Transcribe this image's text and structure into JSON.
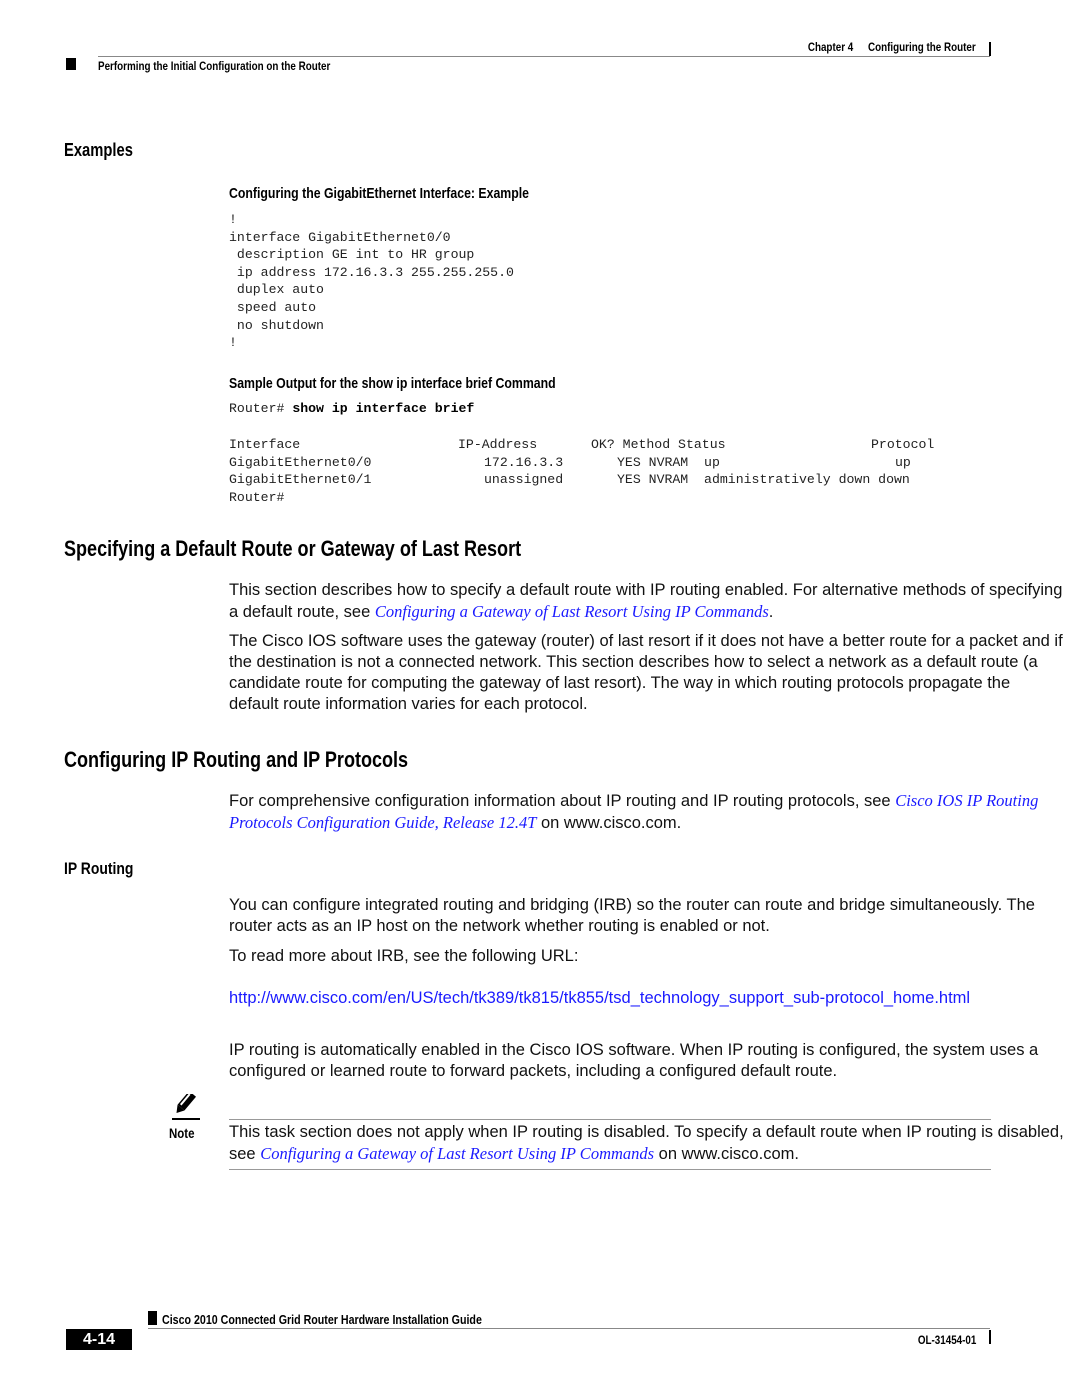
{
  "header": {
    "chapter_label": "Chapter 4",
    "chapter_title": "Configuring the Router",
    "section_title": "Performing the Initial Configuration on the Router"
  },
  "examples": {
    "heading": "Examples",
    "example1": {
      "title": "Configuring the GigabitEthernet Interface: Example",
      "code": "!\ninterface GigabitEthernet0/0\n description GE int to HR group\n ip address 172.16.3.3 255.255.255.0\n duplex auto\n speed auto\n no shutdown\n!"
    },
    "example2": {
      "title": "Sample Output for the show ip interface brief Command",
      "prompt": "Router# ",
      "command": "show ip interface brief",
      "columns": [
        "Interface",
        "IP-Address",
        "OK? Method Status",
        "Protocol"
      ],
      "rows": [
        [
          "GigabitEthernet0/0",
          "172.16.3.3",
          "YES NVRAM  up",
          "up"
        ],
        [
          "GigabitEthernet0/1",
          "unassigned",
          "YES NVRAM  administratively down",
          "down"
        ]
      ],
      "final_prompt": "Router#"
    }
  },
  "section_default_route": {
    "heading": "Specifying a Default Route or Gateway of Last Resort",
    "p1_text": "This section describes how to specify a default route with IP routing enabled. For alternative methods of specifying a default route, see ",
    "p1_link": "Configuring a Gateway of Last Resort Using IP Commands",
    "p1_end": ".",
    "p2_text": "The Cisco IOS software uses the gateway (router) of last resort if it does not have a better route for a packet and if the destination is not a connected network. This section describes how to select a network as a default route (a candidate route for computing the gateway of last resort). The way in which routing protocols propagate the default route information varies for each protocol."
  },
  "section_ip_routing": {
    "heading": "Configuring IP Routing and IP Protocols",
    "p1_text": "For comprehensive configuration information about IP routing and IP routing protocols, see ",
    "p1_link": "Cisco IOS IP Routing Protocols Configuration Guide, Release 12.4T",
    "p1_end": " on www.cisco.com.",
    "subheading": "IP Routing",
    "p2_text": "You can configure integrated routing and bridging (IRB) so the router can route and bridge simultaneously. The router acts as an IP host on the network whether routing is enabled or not.",
    "p3_text": "To read more about IRB, see the following URL:",
    "url": "http://www.cisco.com/en/US/tech/tk389/tk815/tk855/tsd_technology_support_sub-protocol_home.html",
    "p4_text": "IP routing is automatically enabled in the Cisco IOS software. When IP routing is configured, the system uses a configured or learned route to forward packets, including a configured default route."
  },
  "note": {
    "label": "Note",
    "text": "This task section does not apply when IP routing is disabled. To specify a default route when IP routing is disabled, see ",
    "link": "Configuring a Gateway of Last Resort Using IP Commands",
    "end": " on www.cisco.com."
  },
  "footer": {
    "guide_title": "Cisco 2010 Connected Grid Router Hardware Installation Guide",
    "page_number": "4-14",
    "doc_number": "OL-31454-01"
  }
}
